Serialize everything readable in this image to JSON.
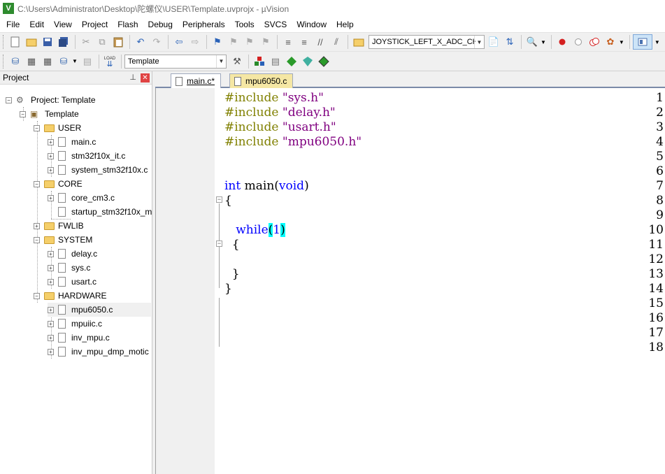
{
  "window": {
    "title": "C:\\Users\\Administrator\\Desktop\\陀螺仪\\USER\\Template.uvprojx - µVision",
    "icon_color": "#2e8b2e"
  },
  "menu": [
    "File",
    "Edit",
    "View",
    "Project",
    "Flash",
    "Debug",
    "Peripherals",
    "Tools",
    "SVCS",
    "Window",
    "Help"
  ],
  "toolbar": {
    "find_combo_value": "JOYSTICK_LEFT_X_ADC_CH",
    "target_combo_value": "Template",
    "load_label": "LOAD"
  },
  "project_panel": {
    "title": "Project",
    "root": "Project: Template",
    "target": "Template",
    "groups": [
      {
        "name": "USER",
        "files": [
          "main.c",
          "stm32f10x_it.c",
          "system_stm32f10x.c"
        ]
      },
      {
        "name": "CORE",
        "files": [
          "core_cm3.c",
          "startup_stm32f10x_m"
        ]
      },
      {
        "name": "FWLIB",
        "files": []
      },
      {
        "name": "SYSTEM",
        "files": [
          "delay.c",
          "sys.c",
          "usart.c"
        ]
      },
      {
        "name": "HARDWARE",
        "files": [
          "mpu6050.c",
          "mpuiic.c",
          "inv_mpu.c",
          "inv_mpu_dmp_motic"
        ]
      }
    ]
  },
  "editor": {
    "tabs": [
      {
        "label": "main.c*",
        "active": true
      },
      {
        "label": "mpu6050.c",
        "active": false
      }
    ],
    "line_numbers": [
      "1",
      "2",
      "3",
      "4",
      "5",
      "6",
      "7",
      "8",
      "9",
      "10",
      "11",
      "12",
      "13",
      "14",
      "15",
      "16",
      "17",
      "18"
    ],
    "code": {
      "l1_dir": "#include ",
      "l1_str": "\"sys.h\"",
      "l2_dir": "#include ",
      "l2_str": "\"delay.h\"",
      "l3_dir": "#include ",
      "l3_str": "\"usart.h\"",
      "l4_dir": "#include ",
      "l4_str": "\"mpu6050.h\"",
      "l7_int": "int",
      "l7_main": " main(",
      "l7_void": "void",
      "l7_close": ")",
      "l8": "{",
      "l10_indent": "   ",
      "l10_while": "while",
      "l10_open": "(",
      "l10_one": "1",
      "l10_close": ")",
      "l11": "  {",
      "l13": "  }",
      "l14": "}"
    }
  }
}
